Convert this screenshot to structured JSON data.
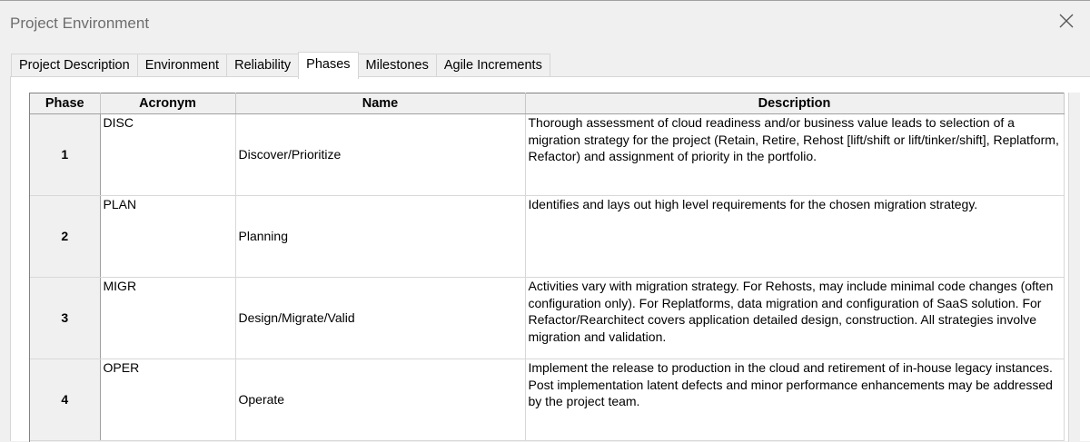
{
  "window": {
    "title": "Project Environment"
  },
  "tabs": [
    {
      "label": "Project Description"
    },
    {
      "label": "Environment"
    },
    {
      "label": "Reliability"
    },
    {
      "label": "Phases"
    },
    {
      "label": "Milestones"
    },
    {
      "label": "Agile Increments"
    }
  ],
  "active_tab": "Phases",
  "table": {
    "columns": [
      "Phase",
      "Acronym",
      "Name",
      "Description"
    ],
    "rows": [
      {
        "phase": "1",
        "acronym": "DISC",
        "name": "Discover/Prioritize",
        "description": "Thorough assessment of cloud readiness and/or business value leads to selection of a migration strategy for the project (Retain, Retire, Rehost [lift/shift or lift/tinker/shift], Replatform, Refactor) and assignment of priority in the portfolio."
      },
      {
        "phase": "2",
        "acronym": "PLAN",
        "name": "Planning",
        "description": "Identifies and lays out high level requirements for the chosen migration strategy."
      },
      {
        "phase": "3",
        "acronym": "MIGR",
        "name": "Design/Migrate/Valid",
        "description": "Activities vary with migration strategy. For Rehosts, may include minimal code changes (often configuration only).  For Replatforms, data migration and configuration of SaaS solution. For Refactor/Rearchitect covers application detailed design, construction. All strategies involve migration and validation."
      },
      {
        "phase": "4",
        "acronym": "OPER",
        "name": "Operate",
        "description": "Implement the release to production in the cloud and retirement of in-house legacy instances.  Post implementation latent defects and minor performance enhancements may be addressed by the project team."
      }
    ]
  }
}
